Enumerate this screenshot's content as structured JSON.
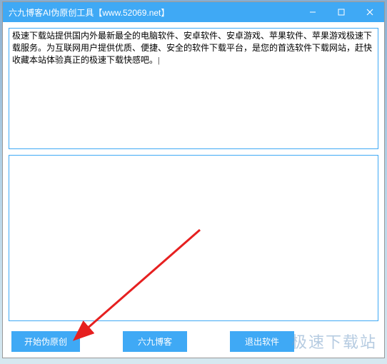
{
  "window": {
    "title": "六九博客AI伪原创工具【www.52069.net】"
  },
  "input": {
    "text": "极速下载站提供国内外最新最全的电脑软件、安卓软件、安卓游戏、苹果软件、苹果游戏极速下载服务。为互联网用户提供优质、便捷、安全的软件下载平台，是您的首选软件下载网站，赶快收藏本站体验真正的极速下载快感吧。|"
  },
  "output": {
    "text": ""
  },
  "buttons": {
    "start": "开始伪原创",
    "blog": "六九博客",
    "exit": "退出软件"
  },
  "watermark": "极速下载站"
}
